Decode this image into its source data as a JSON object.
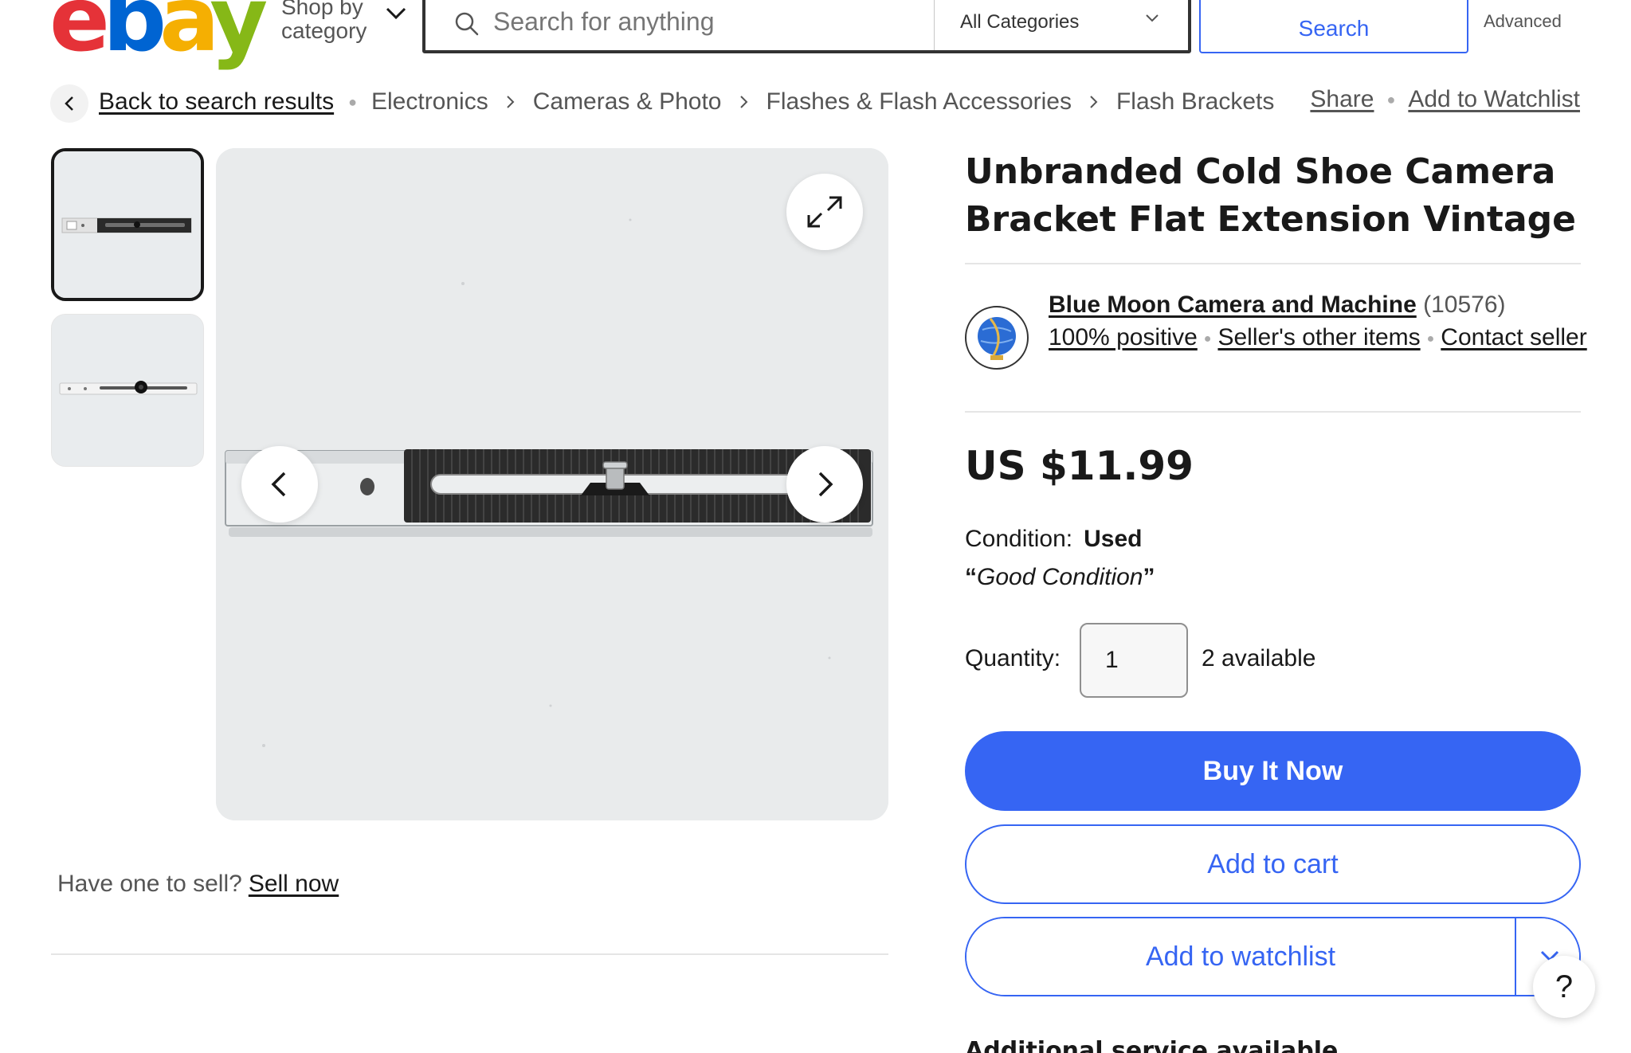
{
  "header": {
    "logo": {
      "e": "e",
      "b": "b",
      "a": "a",
      "y": "y"
    },
    "shop_by_category": "Shop by category",
    "search_placeholder": "Search for anything",
    "category_select": "All Categories",
    "search_button": "Search",
    "advanced_link": "Advanced"
  },
  "breadcrumb": {
    "back": "Back to search results",
    "items": [
      "Electronics",
      "Cameras & Photo",
      "Flashes & Flash Accessories",
      "Flash Brackets"
    ],
    "share": "Share",
    "watchlist": "Add to Watchlist"
  },
  "gallery": {
    "sell_prompt": "Have one to sell?",
    "sell_link": "Sell now"
  },
  "listing": {
    "title": "Unbranded Cold Shoe Camera Bracket Flat Extension Vintage",
    "seller": {
      "name": "Blue Moon Camera and Machine",
      "feedback_count": "(10576)",
      "positive": "100% positive",
      "other_items": "Seller's other items",
      "contact": "Contact seller"
    },
    "price": "US $11.99",
    "condition_label": "Condition:",
    "condition_value": "Used",
    "condition_note": "Good Condition",
    "quantity_label": "Quantity:",
    "quantity_value": "1",
    "available": "2 available",
    "buy_now": "Buy It Now",
    "add_to_cart": "Add to cart",
    "add_to_watchlist": "Add to watchlist",
    "additional_service": "Additional service available"
  },
  "help": "?",
  "colors": {
    "accent": "#3665f3",
    "text": "#191919",
    "muted": "#555555"
  }
}
